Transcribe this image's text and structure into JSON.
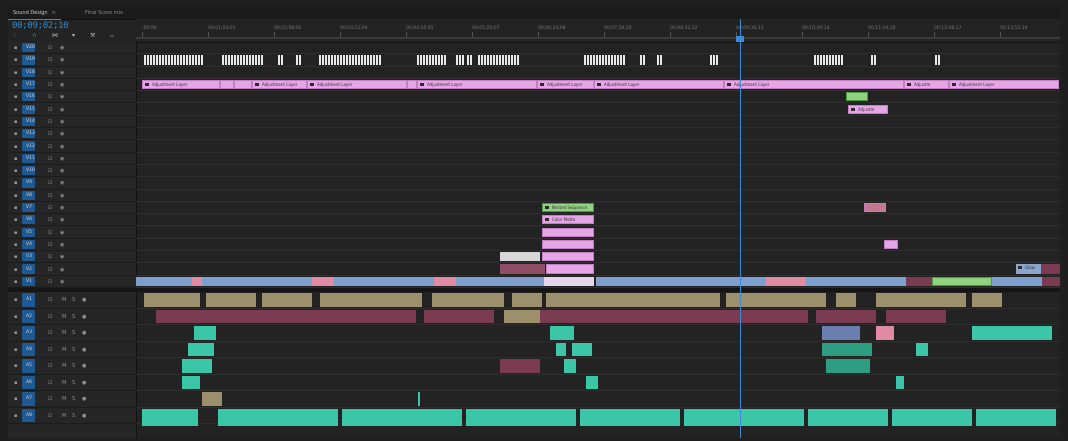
{
  "tabs": [
    {
      "label": "Sound Design",
      "close": "≡",
      "active": true
    },
    {
      "label": "Final Score mix",
      "active": false
    }
  ],
  "timecode": "00;09;02;10",
  "toolbar": {
    "icons": [
      "nest-icon",
      "snap-icon",
      "linked-selection-icon",
      "add-marker-icon",
      "wrench-icon",
      "caption-icon"
    ]
  },
  "ruler": {
    "ticks": [
      ":00;00",
      "00;01;04;01",
      "00;02;08;02",
      "00;03;12;04",
      "00;04;16;05",
      "00;05;20;07",
      "00;06;24;08",
      "00;07;28;10",
      "00;08;32;12",
      "00;09;36;13",
      "00;10;40;14",
      "00;11;44;16",
      "00;12;48;17",
      "00;13;52;19"
    ]
  },
  "video_tracks": [
    "V20",
    "V19",
    "V18",
    "V17",
    "V16",
    "V15",
    "V14",
    "V13",
    "V12",
    "V11",
    "V10",
    "V9",
    "V8",
    "V7",
    "V6",
    "V5",
    "V4",
    "V3",
    "V2",
    "V1"
  ],
  "audio_tracks": [
    "A1",
    "A2",
    "A3",
    "A4",
    "A5",
    "A6",
    "A7",
    "A8"
  ],
  "clip_labels": {
    "adjustment": "Adjustment Layer",
    "nested_sequence": "Nested Sequence",
    "color_matte": "Color Matte",
    "glow": "Glow",
    "adjust_short": "Adjustm"
  },
  "colors": {
    "accent": "#2f8bd6",
    "adjustment": "#e6a5e6",
    "nested": "#8fd27e",
    "video": "#7d9fd0",
    "audio_dialog": "#9c8f6b",
    "audio_music": "#3bc6a8",
    "audio_fx": "#7a3b50"
  }
}
